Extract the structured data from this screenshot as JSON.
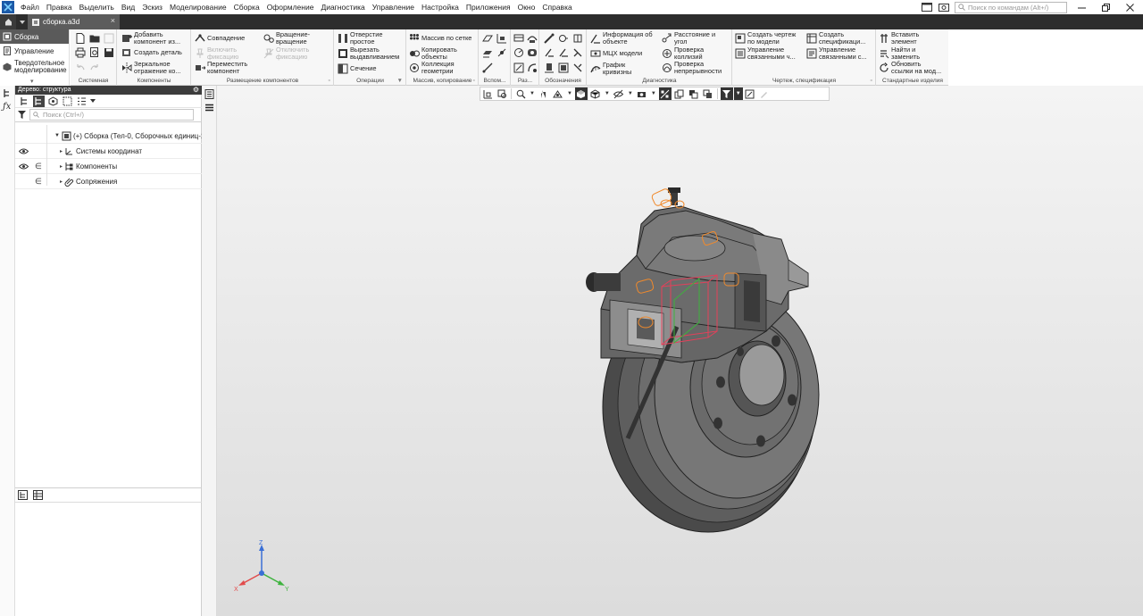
{
  "app": {
    "name": "КОМПАС-3D"
  },
  "menu": [
    "Файл",
    "Правка",
    "Выделить",
    "Вид",
    "Эскиз",
    "Моделирование",
    "Сборка",
    "Оформление",
    "Диагностика",
    "Управление",
    "Настройка",
    "Приложения",
    "Окно",
    "Справка"
  ],
  "command_search": {
    "placeholder": "Поиск по командам (Alt+/)"
  },
  "tab": {
    "title": "сборка.a3d"
  },
  "modes": {
    "assembly": "Сборка",
    "management": "Управление",
    "solid_line1": "Твердотельное",
    "solid_line2": "моделирование"
  },
  "ribbon": {
    "groups": {
      "system": "Системная",
      "components": "Компоненты",
      "placement": "Размещение компонентов",
      "operations": "Операции",
      "array": "Массив, копирование",
      "aux": "Вспом...",
      "sizes": "Раз...",
      "designations": "Обозначения",
      "diagnostics": "Диагностика",
      "drawing_spec": "Чертеж, спецификация",
      "standard": "Стандартные изделия"
    },
    "add_component_1": "Добавить",
    "add_component_2": "компонент из...",
    "create_part": "Создать деталь",
    "mirror_1": "Зеркальное",
    "mirror_2": "отражение ко...",
    "coincidence": "Совпадение",
    "enable_fix_1": "Включить",
    "enable_fix_2": "фиксацию",
    "move_comp_1": "Переместить",
    "move_comp_2": "компонент",
    "rotation_1": "Вращение-",
    "rotation_2": "вращение",
    "disable_fix_1": "Отключить",
    "disable_fix_2": "фиксацию",
    "hole_1": "Отверстие",
    "hole_2": "простое",
    "cut_1": "Вырезать",
    "cut_2": "выдавливанием",
    "section": "Сечение",
    "grid_array": "Массив по сетке",
    "copy_obj_1": "Копировать",
    "copy_obj_2": "объекты",
    "geom_coll_1": "Коллекция",
    "geom_coll_2": "геометрии",
    "info_1": "Информация об",
    "info_2": "объекте",
    "mcx": "МЦХ модели",
    "curv_1": "График",
    "curv_2": "кривизны",
    "dist_1": "Расстояние и",
    "dist_2": "угол",
    "collision_1": "Проверка",
    "collision_2": "коллизий",
    "cont_1": "Проверка",
    "cont_2": "непрерывности",
    "drawing_1": "Создать чертеж",
    "drawing_2": "по модели",
    "linked_1": "Управление",
    "linked_2": "связанными ч...",
    "spec_1": "Создать",
    "spec_2": "спецификаци...",
    "linked_spec_1": "Управление",
    "linked_spec_2": "связанными с...",
    "insert_1": "Вставить",
    "insert_2": "элемент",
    "find_1": "Найти и",
    "find_2": "заменить",
    "update_1": "Обновить",
    "update_2": "ссылки на мод..."
  },
  "tree": {
    "title": "Дерево: структура",
    "search_placeholder": "Поиск (Ctrl+/)",
    "root": "(+) Сборка (Тел-0, Сборочных единиц-1",
    "coord_systems": "Системы координат",
    "components": "Компоненты",
    "mates": "Сопряжения"
  },
  "axes": {
    "x": "X",
    "y": "Y",
    "z": "Z"
  },
  "colors": {
    "accent": "#3c3c3c",
    "selection": "#f08a2c",
    "model": "#6f6f6f"
  }
}
